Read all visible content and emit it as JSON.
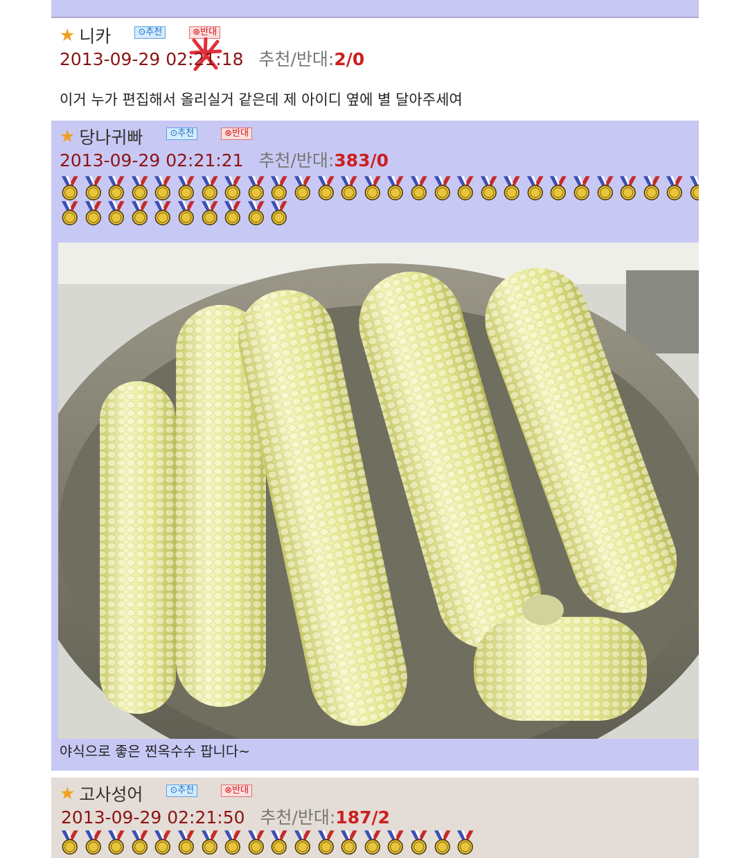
{
  "comments": [
    {
      "nickname": "니카",
      "upvote_label": "⊙추천",
      "downvote_label": "⊗반대",
      "datetime": "2013-09-29 02:21:18",
      "vote_label": "추천/반대:",
      "votes": "2/0",
      "text": "이거 누가 편집해서 올리실거 같은데 제 아이디 옆에 별 달아주세여"
    },
    {
      "nickname": "당나귀빠",
      "upvote_label": "⊙추천",
      "downvote_label": "⊗반대",
      "datetime": "2013-09-29 02:21:21",
      "vote_label": "추천/반대:",
      "votes": "383/0",
      "medal_rows": [
        28,
        10
      ],
      "image_alt": "steamed corn in pot",
      "text": "야식으로 좋은 찐옥수수 팝니다~"
    },
    {
      "nickname": "고사성어",
      "upvote_label": "⊙추천",
      "downvote_label": "⊗반대",
      "datetime": "2013-09-29 02:21:50",
      "vote_label": "추천/반대:",
      "votes": "187/2",
      "medal_rows": [
        18
      ]
    }
  ],
  "colors": {
    "highlight_bg": "#c8c8f4",
    "comment3_bg": "#e4dcd6",
    "date": "#8b1414",
    "votes": "#cc1f1f",
    "star": "#f0a020"
  },
  "icons": [
    "star-icon",
    "medal-icon",
    "scribble-star-icon"
  ]
}
